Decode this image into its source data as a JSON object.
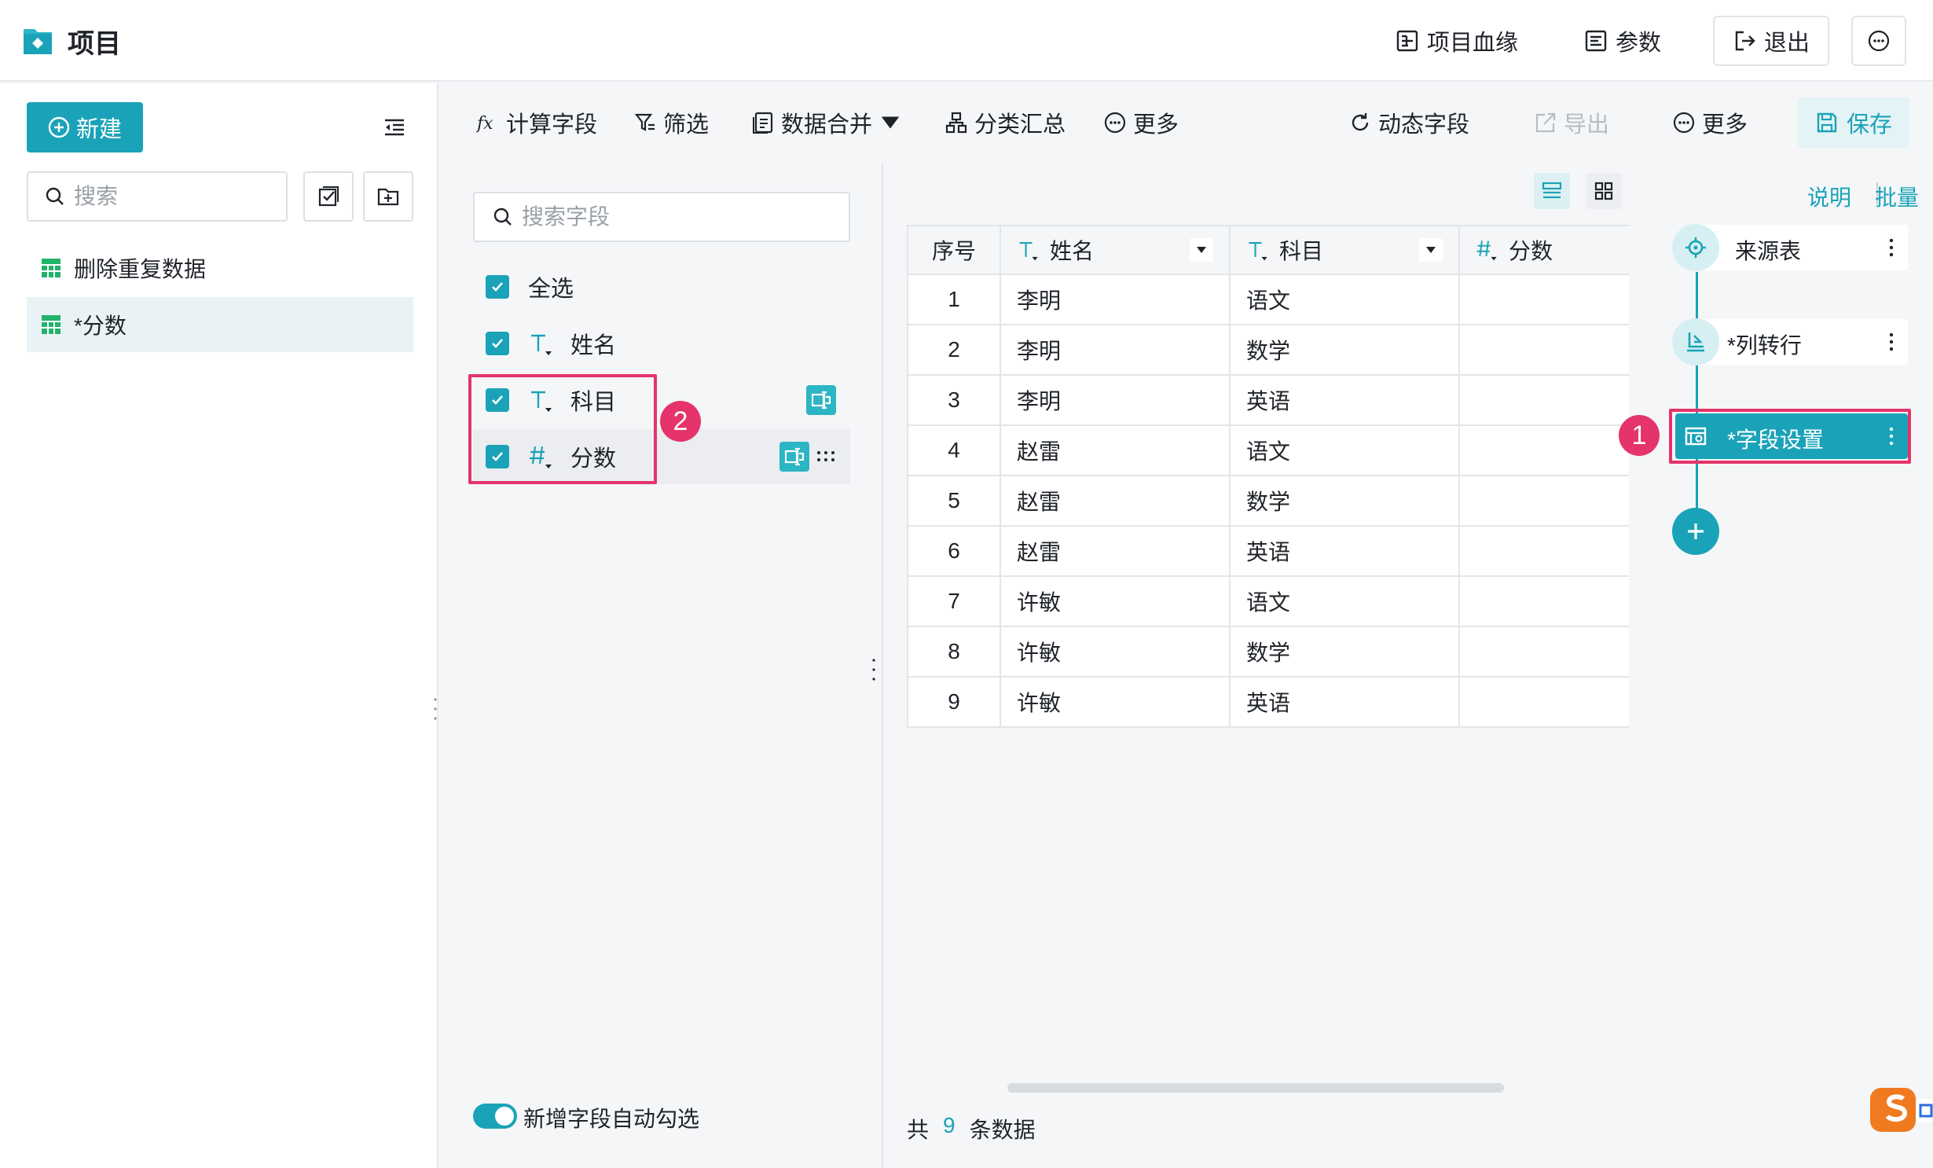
{
  "header": {
    "title": "项目",
    "lineage_label": "项目血缘",
    "params_label": "参数",
    "exit_label": "退出"
  },
  "sidebar": {
    "new_label": "新建",
    "search_placeholder": "搜索",
    "items": [
      {
        "label": "删除重复数据",
        "icon": "table-icon"
      },
      {
        "label": "*分数",
        "icon": "table-icon",
        "active": true
      }
    ]
  },
  "toolbar": {
    "calc_field": "计算字段",
    "filter": "筛选",
    "merge": "数据合并",
    "group_summary": "分类汇总",
    "more_left": "更多",
    "dynamic_field": "动态字段",
    "export": "导出",
    "more_right": "更多",
    "save": "保存"
  },
  "field_panel": {
    "search_placeholder": "搜索字段",
    "select_all": "全选",
    "fields": [
      {
        "name": "姓名",
        "type": "text",
        "checked": true
      },
      {
        "name": "科目",
        "type": "text",
        "checked": true
      },
      {
        "name": "分数",
        "type": "number",
        "checked": true
      }
    ],
    "auto_check_label": "新增字段自动勾选",
    "auto_check_on": true,
    "callout_number": "2"
  },
  "table": {
    "columns": [
      "序号",
      "姓名",
      "科目",
      "分数"
    ],
    "rows": [
      [
        "1",
        "李明",
        "语文",
        ""
      ],
      [
        "2",
        "李明",
        "数学",
        ""
      ],
      [
        "3",
        "李明",
        "英语",
        ""
      ],
      [
        "4",
        "赵雷",
        "语文",
        ""
      ],
      [
        "5",
        "赵雷",
        "数学",
        ""
      ],
      [
        "6",
        "赵雷",
        "英语",
        ""
      ],
      [
        "7",
        "许敏",
        "语文",
        ""
      ],
      [
        "8",
        "许敏",
        "数学",
        ""
      ],
      [
        "9",
        "许敏",
        "英语",
        ""
      ]
    ],
    "footer_prefix": "共",
    "footer_count": "9",
    "footer_suffix": "条数据"
  },
  "flow": {
    "explain_link": "说明",
    "batch_link": "批量",
    "steps": [
      {
        "label": "来源表",
        "icon": "source-icon"
      },
      {
        "label": "*列转行",
        "icon": "unpivot-icon"
      },
      {
        "label": "*字段设置",
        "icon": "field-settings-icon",
        "selected": true
      }
    ],
    "callout_number": "1"
  },
  "colors": {
    "accent": "#1aa3b8",
    "highlight": "#e5336b"
  }
}
